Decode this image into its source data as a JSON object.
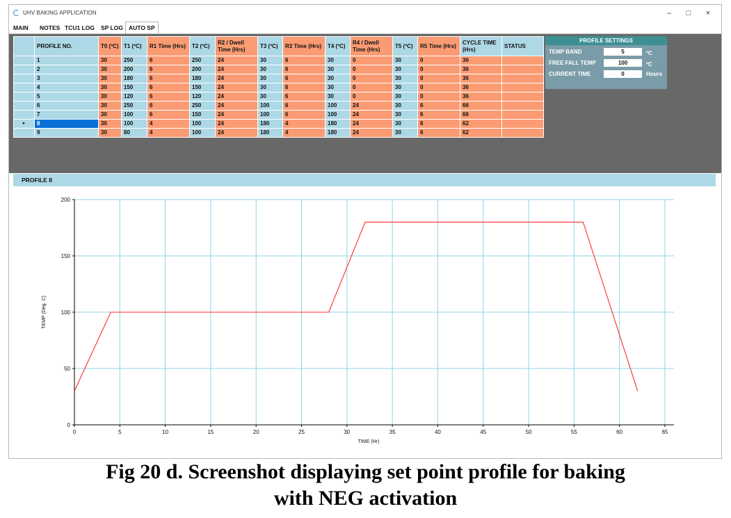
{
  "app": {
    "title": "UHV BAKING APPLICATION",
    "controls": {
      "minimize": "–",
      "maximize": "□",
      "close": "×"
    }
  },
  "tabs": [
    {
      "label": "MAIN"
    },
    {
      "label": "NOTES"
    },
    {
      "label": "TCU1 LOG"
    },
    {
      "label": "SP LOG"
    },
    {
      "label": "AUTO SP",
      "active": true
    }
  ],
  "table": {
    "columns": [
      "PROFILE NO.",
      "T0 (ºC)",
      "T1 (ºC)",
      "R1 Time (Hrs)",
      "T2 (ºC)",
      "R2 / Dwell Time (Hrs)",
      "T3 (ºC)",
      "R3 Time (Hrs)",
      "T4 (ºC)",
      "R4 / Dwell Time (Hrs)",
      "T5 (ºC)",
      "R5 Time (Hrs)",
      "CYCLE TIME (Hrs)",
      "STATUS"
    ],
    "rows": [
      [
        "1",
        "30",
        "250",
        "6",
        "250",
        "24",
        "30",
        "6",
        "30",
        "0",
        "30",
        "0",
        "36",
        ""
      ],
      [
        "2",
        "30",
        "200",
        "6",
        "200",
        "24",
        "30",
        "6",
        "30",
        "0",
        "30",
        "0",
        "36",
        ""
      ],
      [
        "3",
        "30",
        "180",
        "6",
        "180",
        "24",
        "30",
        "6",
        "30",
        "0",
        "30",
        "0",
        "36",
        ""
      ],
      [
        "4",
        "30",
        "150",
        "6",
        "150",
        "24",
        "30",
        "6",
        "30",
        "0",
        "30",
        "0",
        "36",
        ""
      ],
      [
        "5",
        "30",
        "120",
        "6",
        "120",
        "24",
        "30",
        "6",
        "30",
        "0",
        "30",
        "0",
        "36",
        ""
      ],
      [
        "6",
        "30",
        "250",
        "6",
        "250",
        "24",
        "100",
        "6",
        "100",
        "24",
        "30",
        "6",
        "66",
        ""
      ],
      [
        "7",
        "30",
        "100",
        "6",
        "150",
        "24",
        "100",
        "6",
        "100",
        "24",
        "30",
        "6",
        "66",
        ""
      ],
      [
        "8",
        "30",
        "100",
        "4",
        "100",
        "24",
        "180",
        "4",
        "180",
        "24",
        "30",
        "6",
        "62",
        ""
      ],
      [
        "9",
        "30",
        "80",
        "4",
        "100",
        "24",
        "180",
        "4",
        "180",
        "24",
        "30",
        "6",
        "62",
        ""
      ]
    ],
    "selected_row": 7,
    "row_pointer": "▸"
  },
  "profile_settings": {
    "title": "PROFILE SETTINGS",
    "fields": [
      {
        "label": "TEMP BAND",
        "value": "5",
        "unit": "ºC"
      },
      {
        "label": "FREE FALL TEMP",
        "value": "100",
        "unit": "ºC"
      },
      {
        "label": "CURRENT TIME",
        "value": "0",
        "unit": "Hours"
      }
    ]
  },
  "profile_label": "PROFILE 8",
  "chart_data": {
    "type": "line",
    "xlabel": "TIME (Hr)",
    "ylabel": "TEMP (Deg. C)",
    "xlim": [
      0,
      66
    ],
    "ylim": [
      0,
      200
    ],
    "xticks": [
      0,
      5,
      10,
      15,
      20,
      25,
      30,
      35,
      40,
      45,
      50,
      55,
      60,
      65
    ],
    "yticks": [
      0,
      50,
      100,
      150,
      200
    ],
    "grid": true,
    "series": [
      {
        "color": "#ff2a2a",
        "x": [
          0,
          4,
          28,
          32,
          56,
          62
        ],
        "y": [
          30,
          100,
          100,
          180,
          180,
          30
        ]
      }
    ]
  },
  "caption": {
    "line1": "Fig 20 d. Screenshot displaying set point profile for baking",
    "line2": "with NEG activation"
  }
}
